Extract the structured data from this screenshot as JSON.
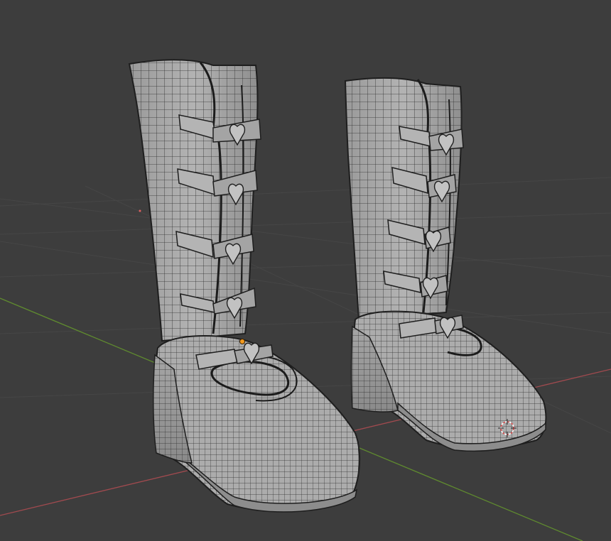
{
  "viewport": {
    "background": "#3d3d3d",
    "grid_color": "#474747",
    "x_axis_color": "#a14a4f",
    "y_axis_color": "#5f8a2f",
    "mesh_fill": "#a9a9a9",
    "mesh_shade": "#8c8c8c",
    "mesh_wire": "#262626",
    "origin_color": "#f39a1e",
    "cursor_color": "#d84b4b"
  },
  "scene": {
    "objects": [
      {
        "name": "boot-left",
        "buckles": 5,
        "heart_charms": 5
      },
      {
        "name": "boot-right",
        "buckles": 5,
        "heart_charms": 5
      }
    ],
    "icons": [
      "object-origin-icon",
      "3d-cursor-icon"
    ]
  }
}
